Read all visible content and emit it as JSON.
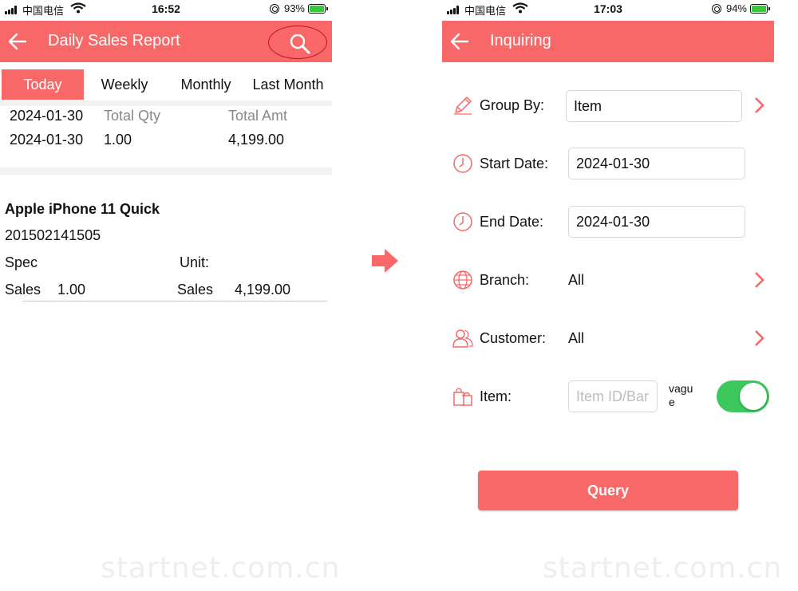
{
  "left": {
    "status": {
      "carrier": "中国电信",
      "time": "16:52",
      "battery": "93%"
    },
    "header": {
      "title": "Daily Sales Report",
      "back_icon": "back-arrow-icon",
      "search_icon": "search-icon"
    },
    "tabs": [
      "Today",
      "Weekly",
      "Monthly",
      "Last Month"
    ],
    "active_tab": "Today",
    "summary": {
      "headers": [
        "2024-01-30",
        "Total Qty",
        "Total Amt"
      ],
      "row": [
        "2024-01-30",
        "1.00",
        "4,199.00"
      ]
    },
    "item": {
      "name": "Apple iPhone 11 Quick",
      "code": "201502141505",
      "spec_label": "Spec",
      "unit_label": "Unit:",
      "sales_qty_label": "Sales",
      "sales_qty": "1.00",
      "sales_amt_label": "Sales",
      "sales_amt": "4,199.00"
    },
    "watermark": "startnet.com.cn"
  },
  "arrow_icon": "right-arrow-icon",
  "right": {
    "status": {
      "carrier": "中国电信",
      "time": "17:03",
      "battery": "94%"
    },
    "header": {
      "title": "Inquiring",
      "back_icon": "back-arrow-icon"
    },
    "form": {
      "group_by": {
        "label": "Group By:",
        "value": "Item",
        "icon": "pencil-icon"
      },
      "start_date": {
        "label": "Start Date:",
        "value": "2024-01-30",
        "icon": "clock-icon"
      },
      "end_date": {
        "label": "End Date:",
        "value": "2024-01-30",
        "icon": "clock-icon"
      },
      "branch": {
        "label": "Branch:",
        "value": "All",
        "icon": "globe-icon"
      },
      "customer": {
        "label": "Customer:",
        "value": "All",
        "icon": "users-icon"
      },
      "item": {
        "label": "Item:",
        "placeholder": "Item ID/Bar",
        "icon": "shopping-bag-icon",
        "vague_label": "vague",
        "vague_on": true
      }
    },
    "query_label": "Query",
    "watermark": "startnet.com.cn"
  },
  "colors": {
    "accent": "#f96868",
    "toggle_on": "#3cc85c"
  }
}
